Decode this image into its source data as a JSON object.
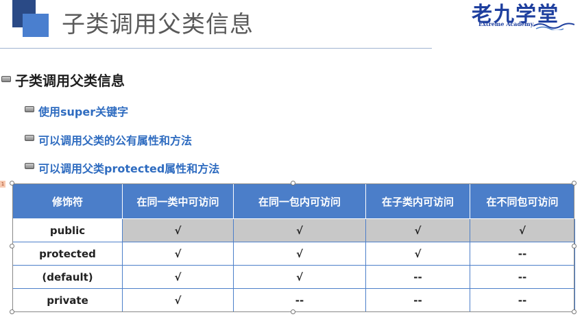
{
  "slide": {
    "title": "子类调用父类信息"
  },
  "logo": {
    "text": "老九学堂",
    "tagline": "Extreme Academy"
  },
  "bullets": {
    "main": "子类调用父类信息",
    "items": [
      "使用super关键字",
      "可以调用父类的公有属性和方法",
      "可以调用父类protected属性和方法"
    ]
  },
  "table": {
    "headers": [
      "修饰符",
      "在同一类中可访问",
      "在同一包内可访问",
      "在子类内可访问",
      "在不同包可访问"
    ],
    "rows": [
      [
        "public",
        "√",
        "√",
        "√",
        "√"
      ],
      [
        "protected",
        "√",
        "√",
        "√",
        "--"
      ],
      [
        "(default)",
        "√",
        "√",
        "--",
        "--"
      ],
      [
        "private",
        "√",
        "--",
        "--",
        "--"
      ]
    ]
  },
  "selection_tag": "1",
  "colors": {
    "accent": "#4b7ec9",
    "bullet_text": "#2f6cc0",
    "highlight_row": "#c8c8c8",
    "logo": "#1e3f9e"
  }
}
